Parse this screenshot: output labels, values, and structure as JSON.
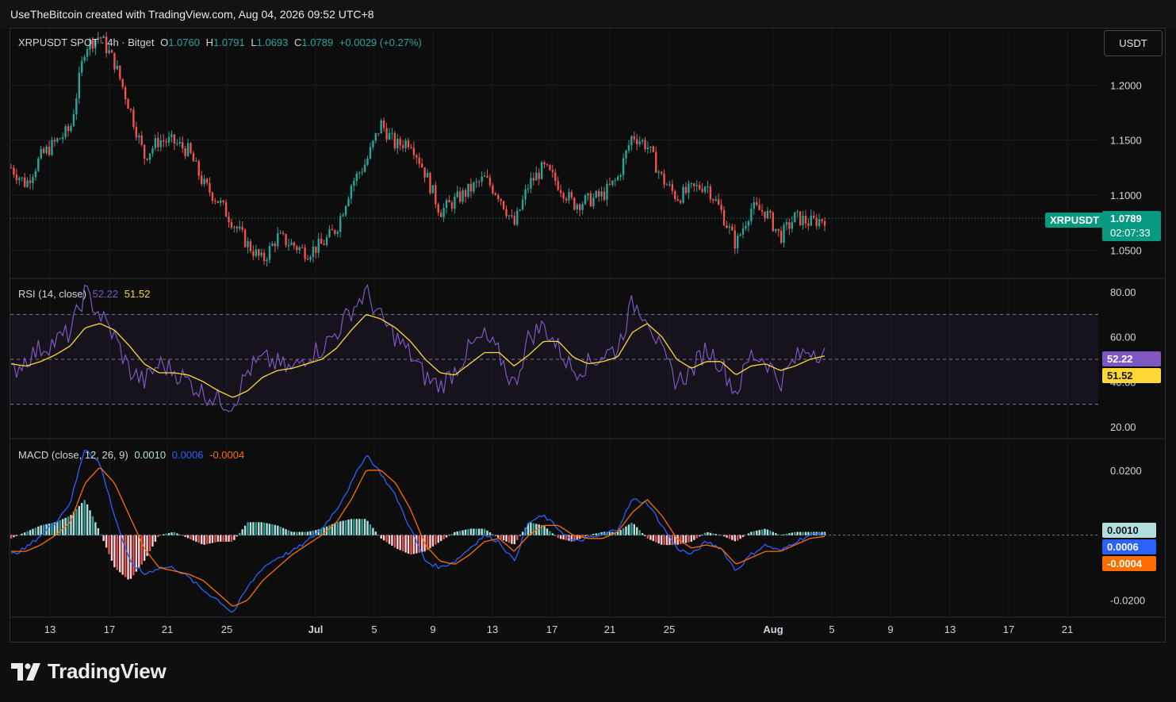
{
  "header": {
    "credit": "UseTheBitcoin created with TradingView.com, Aug 04, 2026 09:52 UTC+8"
  },
  "symbol_legend": {
    "title": "XRPUSDT SPOT · 4h · Bitget",
    "o_label": "O",
    "o": "1.0760",
    "h_label": "H",
    "h": "1.0791",
    "l_label": "L",
    "l": "1.0693",
    "c_label": "C",
    "c": "1.0789",
    "change": "+0.0029 (+0.27%)"
  },
  "currency_button": "USDT",
  "price_tag": {
    "symbol": "XRPUSDT",
    "price": "1.0789",
    "countdown": "02:07:33"
  },
  "rsi_legend": {
    "title": "RSI (14, close)",
    "rsi": "52.22",
    "ma": "51.52"
  },
  "macd_legend": {
    "title": "MACD (close, 12, 26, 9)",
    "hist": "0.0010",
    "macd": "0.0006",
    "signal": "-0.0004"
  },
  "tags": {
    "rsi": "52.22",
    "rsi_ma": "51.52",
    "macd_hist": "0.0010",
    "macd": "0.0006",
    "signal": "-0.0004"
  },
  "logo": {
    "text": "TradingView"
  },
  "colors": {
    "up": "#26a69a",
    "down": "#ef5350",
    "rsi": "#7e57c2",
    "rsi_ma": "#fdd835",
    "macd": "#2962ff",
    "signal": "#ff6d00",
    "hist_up": "#b2dfdb",
    "hist_down": "#ffcdd2",
    "price_tag": "#089981"
  },
  "chart_data": [
    {
      "type": "candlestick",
      "title": "XRPUSDT SPOT · 4h · Bitget",
      "ylim": [
        1.025,
        1.25
      ],
      "y_ticks": [
        "1.0500",
        "1.1000",
        "1.1500",
        "1.2000"
      ],
      "x_ticks": [
        "13",
        "17",
        "21",
        "25",
        "Jul",
        "5",
        "9",
        "13",
        "17",
        "21",
        "25",
        "Aug",
        "5",
        "9",
        "13",
        "17",
        "21"
      ],
      "close_path": [
        {
          "date": "2026-06-11",
          "close": 1.125
        },
        {
          "date": "2026-06-12",
          "close": 1.11
        },
        {
          "date": "2026-06-13",
          "close": 1.135
        },
        {
          "date": "2026-06-14",
          "close": 1.148
        },
        {
          "date": "2026-06-15",
          "close": 1.16
        },
        {
          "date": "2026-06-15.7",
          "close": 1.235
        },
        {
          "date": "2026-06-16",
          "close": 1.245
        },
        {
          "date": "2026-06-17",
          "close": 1.22
        },
        {
          "date": "2026-06-18",
          "close": 1.18
        },
        {
          "date": "2026-06-19",
          "close": 1.135
        },
        {
          "date": "2026-06-20",
          "close": 1.15
        },
        {
          "date": "2026-06-21",
          "close": 1.148
        },
        {
          "date": "2026-06-22",
          "close": 1.14
        },
        {
          "date": "2026-06-23",
          "close": 1.11
        },
        {
          "date": "2026-06-24",
          "close": 1.095
        },
        {
          "date": "2026-06-25",
          "close": 1.075
        },
        {
          "date": "2026-06-26",
          "close": 1.055
        },
        {
          "date": "2026-06-27",
          "close": 1.04
        },
        {
          "date": "2026-06-28",
          "close": 1.062
        },
        {
          "date": "2026-06-29",
          "close": 1.055
        },
        {
          "date": "2026-06-30",
          "close": 1.048
        },
        {
          "date": "2026-07-01",
          "close": 1.055
        },
        {
          "date": "2026-07-02",
          "close": 1.07
        },
        {
          "date": "2026-07-03",
          "close": 1.11
        },
        {
          "date": "2026-07-04",
          "close": 1.13
        },
        {
          "date": "2026-07-05",
          "close": 1.165
        },
        {
          "date": "2026-07-06",
          "close": 1.145
        },
        {
          "date": "2026-07-07",
          "close": 1.15
        },
        {
          "date": "2026-07-08",
          "close": 1.12
        },
        {
          "date": "2026-07-09",
          "close": 1.085
        },
        {
          "date": "2026-07-10",
          "close": 1.095
        },
        {
          "date": "2026-07-11",
          "close": 1.105
        },
        {
          "date": "2026-07-12",
          "close": 1.115
        },
        {
          "date": "2026-07-13",
          "close": 1.1
        },
        {
          "date": "2026-07-14",
          "close": 1.072
        },
        {
          "date": "2026-07-15",
          "close": 1.11
        },
        {
          "date": "2026-07-16",
          "close": 1.125
        },
        {
          "date": "2026-07-17",
          "close": 1.11
        },
        {
          "date": "2026-07-18",
          "close": 1.092
        },
        {
          "date": "2026-07-19",
          "close": 1.095
        },
        {
          "date": "2026-07-20",
          "close": 1.1
        },
        {
          "date": "2026-07-21",
          "close": 1.115
        },
        {
          "date": "2026-07-22",
          "close": 1.155
        },
        {
          "date": "2026-07-23",
          "close": 1.145
        },
        {
          "date": "2026-07-24",
          "close": 1.115
        },
        {
          "date": "2026-07-25",
          "close": 1.098
        },
        {
          "date": "2026-07-26",
          "close": 1.105
        },
        {
          "date": "2026-07-27",
          "close": 1.11
        },
        {
          "date": "2026-07-28",
          "close": 1.085
        },
        {
          "date": "2026-07-29",
          "close": 1.055
        },
        {
          "date": "2026-07-30",
          "close": 1.088
        },
        {
          "date": "2026-07-31",
          "close": 1.085
        },
        {
          "date": "2026-08-01",
          "close": 1.062
        },
        {
          "date": "2026-08-02",
          "close": 1.08
        },
        {
          "date": "2026-08-03",
          "close": 1.075
        },
        {
          "date": "2026-08-04",
          "close": 1.0789
        }
      ],
      "last_price": 1.0789
    },
    {
      "type": "line",
      "title": "RSI (14, close)",
      "ylim": [
        15,
        85
      ],
      "y_ticks": [
        "20.00",
        "40.00",
        "60.00",
        "80.00"
      ],
      "bands": [
        30,
        50,
        70
      ],
      "series": [
        {
          "name": "RSI",
          "values": [
            44,
            50,
            55,
            58,
            62,
            80,
            70,
            60,
            45,
            40,
            48,
            45,
            40,
            35,
            32,
            30,
            45,
            50,
            48,
            45,
            52,
            55,
            62,
            72,
            80,
            68,
            60,
            52,
            42,
            38,
            45,
            55,
            60,
            52,
            38,
            60,
            65,
            55,
            45,
            48,
            52,
            55,
            75,
            70,
            52,
            40,
            45,
            55,
            48,
            35,
            52,
            50,
            40,
            50,
            55,
            52.22
          ]
        },
        {
          "name": "MA",
          "values": [
            48,
            47,
            49,
            52,
            56,
            64,
            66,
            63,
            56,
            48,
            44,
            44,
            43,
            40,
            36,
            33,
            36,
            42,
            45,
            46,
            48,
            50,
            55,
            63,
            70,
            68,
            64,
            58,
            50,
            44,
            43,
            48,
            53,
            53,
            47,
            52,
            58,
            58,
            51,
            48,
            49,
            51,
            62,
            66,
            60,
            50,
            46,
            49,
            49,
            43,
            47,
            48,
            45,
            47,
            50,
            51.52
          ]
        }
      ]
    },
    {
      "type": "bar+line",
      "title": "MACD (close, 12, 26, 9)",
      "ylim": [
        -0.025,
        0.029
      ],
      "y_ticks": [
        "-0.0200",
        "0.0200"
      ],
      "series": [
        {
          "name": "MACD",
          "values": [
            -0.006,
            -0.004,
            0.0,
            0.004,
            0.01,
            0.027,
            0.022,
            0.006,
            -0.008,
            -0.012,
            -0.01,
            -0.01,
            -0.013,
            -0.017,
            -0.02,
            -0.024,
            -0.016,
            -0.01,
            -0.007,
            -0.005,
            -0.002,
            0.002,
            0.008,
            0.016,
            0.025,
            0.019,
            0.012,
            0.002,
            -0.008,
            -0.01,
            -0.008,
            -0.004,
            0.0,
            -0.002,
            -0.008,
            0.004,
            0.006,
            0.002,
            -0.002,
            -0.001,
            0.0,
            0.002,
            0.011,
            0.01,
            0.003,
            -0.004,
            -0.006,
            -0.002,
            -0.004,
            -0.011,
            -0.006,
            -0.003,
            -0.005,
            -0.002,
            0.0,
            0.0006
          ]
        },
        {
          "name": "Signal",
          "values": [
            -0.005,
            -0.005,
            -0.003,
            0.0,
            0.004,
            0.016,
            0.021,
            0.016,
            0.006,
            -0.004,
            -0.01,
            -0.011,
            -0.012,
            -0.014,
            -0.018,
            -0.022,
            -0.02,
            -0.014,
            -0.01,
            -0.006,
            -0.003,
            0.0,
            0.004,
            0.011,
            0.02,
            0.02,
            0.016,
            0.008,
            -0.003,
            -0.008,
            -0.009,
            -0.006,
            -0.002,
            -0.001,
            -0.005,
            0.0,
            0.003,
            0.003,
            0.0,
            -0.001,
            -0.001,
            0.001,
            0.007,
            0.011,
            0.006,
            -0.001,
            -0.004,
            -0.003,
            -0.004,
            -0.009,
            -0.007,
            -0.005,
            -0.005,
            -0.003,
            -0.001,
            -0.0004
          ]
        },
        {
          "name": "Histogram",
          "values": [
            -0.001,
            0.001,
            0.003,
            0.004,
            0.006,
            0.011,
            0.001,
            -0.01,
            -0.014,
            -0.008,
            0.0,
            0.001,
            -0.001,
            -0.003,
            -0.002,
            -0.002,
            0.004,
            0.004,
            0.003,
            0.001,
            0.001,
            0.002,
            0.004,
            0.005,
            0.005,
            -0.001,
            -0.004,
            -0.006,
            -0.005,
            -0.002,
            0.001,
            0.002,
            0.002,
            -0.001,
            -0.003,
            0.004,
            0.003,
            -0.001,
            -0.002,
            0.0,
            0.001,
            0.001,
            0.004,
            -0.001,
            -0.003,
            -0.003,
            -0.002,
            0.001,
            0.0,
            -0.002,
            0.001,
            0.002,
            0.0,
            0.001,
            0.001,
            0.001
          ]
        }
      ]
    }
  ]
}
